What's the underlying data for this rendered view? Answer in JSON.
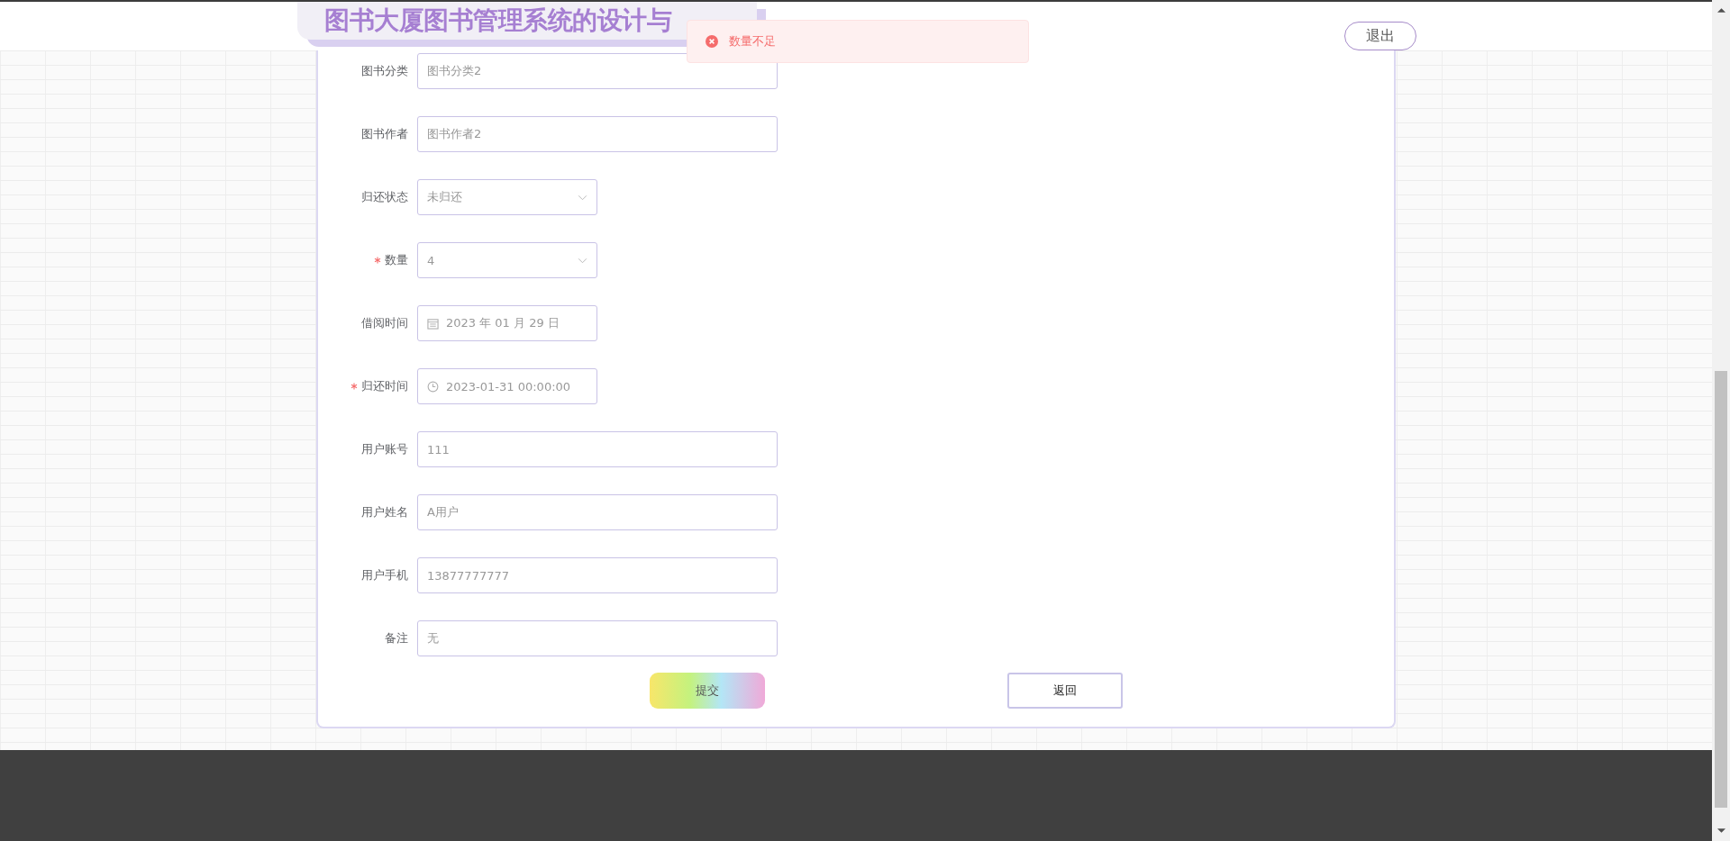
{
  "header": {
    "title": "图书大厦图书管理系统的设计与",
    "logout": "退出"
  },
  "toast": {
    "kind": "error",
    "message": "数量不足"
  },
  "form": {
    "fields": [
      {
        "kind": "text",
        "label": "图书分类",
        "required": false,
        "value": "图书分类2"
      },
      {
        "kind": "text",
        "label": "图书作者",
        "required": false,
        "value": "图书作者2"
      },
      {
        "kind": "select",
        "label": "归还状态",
        "required": false,
        "value": "未归还"
      },
      {
        "kind": "select",
        "label": "数量",
        "required": true,
        "value": "4"
      },
      {
        "kind": "date",
        "label": "借阅时间",
        "required": false,
        "value": "2023 年 01 月 29 日"
      },
      {
        "kind": "time",
        "label": "归还时间",
        "required": true,
        "value": "2023-01-31 00:00:00"
      },
      {
        "kind": "text",
        "label": "用户账号",
        "required": false,
        "value": "111"
      },
      {
        "kind": "text",
        "label": "用户姓名",
        "required": false,
        "value": "A用户"
      },
      {
        "kind": "text",
        "label": "用户手机",
        "required": false,
        "value": "13877777777"
      },
      {
        "kind": "text",
        "label": "备注",
        "required": false,
        "value": "无"
      }
    ],
    "buttons": [
      {
        "kind": "submit",
        "label": "提交"
      },
      {
        "kind": "back",
        "label": "返回"
      }
    ]
  }
}
